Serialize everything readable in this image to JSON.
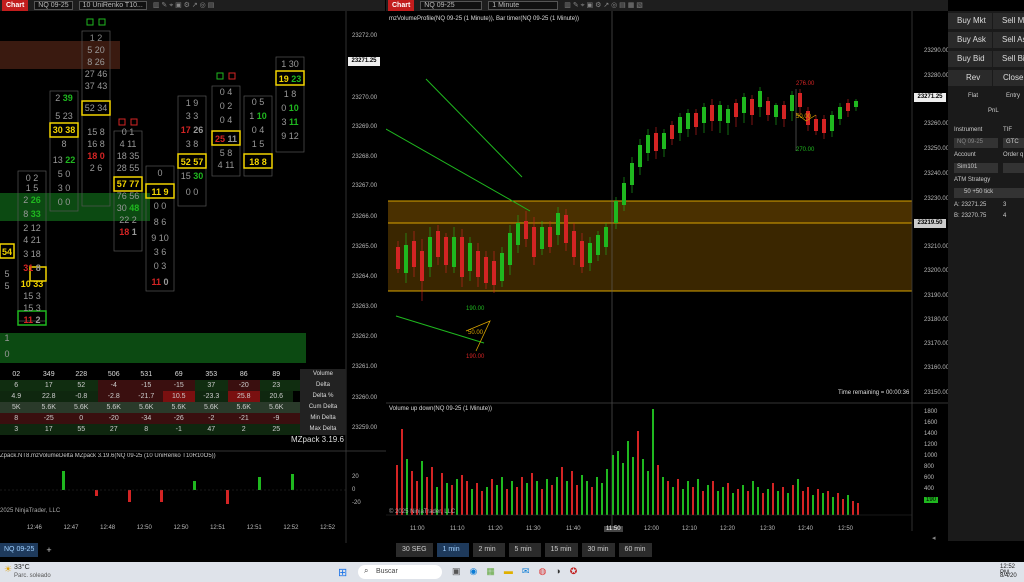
{
  "left_chart": {
    "tab": "Chart",
    "instrument": "NQ 09-25",
    "bar_type": "10 UniRenko T10...",
    "price_axis": [
      "23272.00",
      "23271.00",
      "23270.00",
      "23269.00",
      "23268.00",
      "23267.00",
      "23266.00",
      "23265.00",
      "23264.00",
      "23263.00",
      "23262.00",
      "23261.00",
      "23260.00",
      "23259.00"
    ],
    "current_price": "23271.25",
    "time_axis": [
      "12:46",
      "12:47",
      "12:48",
      "12:50",
      "12:50",
      "12:51",
      "12:51",
      "12:52",
      "12:52"
    ],
    "stats_rows": [
      {
        "label": "Volume",
        "values": [
          "02",
          "349",
          "228",
          "506",
          "531",
          "69",
          "353",
          "86",
          "89",
          "136"
        ]
      },
      {
        "label": "Delta",
        "values": [
          "6",
          "17",
          "52",
          "-4",
          "-15",
          "-15",
          "37",
          "-20",
          "23",
          "28"
        ]
      },
      {
        "label": "Delta %",
        "values": [
          "4.9",
          "22.8",
          "-0.8",
          "-2.8",
          "-21.7",
          "10.5",
          "-23.3",
          "25.8",
          "20.6"
        ]
      },
      {
        "label": "Cum Delta",
        "values": [
          "5K",
          "5.6K",
          "5.6K",
          "5.6K",
          "5.6K",
          "5.6K",
          "5.6K",
          "5.6K",
          "5.6K",
          "5.7K"
        ]
      },
      {
        "label": "Min Delta",
        "values": [
          "8",
          "-25",
          "0",
          "-20",
          "-34",
          "-26",
          "-2",
          "-21",
          "-9",
          "1"
        ]
      },
      {
        "label": "Max Delta",
        "values": [
          "3",
          "17",
          "55",
          "27",
          "8",
          "-1",
          "47",
          "2",
          "25",
          "31"
        ]
      }
    ],
    "watermark": "MZpack 3.19.6",
    "lower_title": "Zpack.NT8.mzVolumeDelta MZpack 3.19.6(NQ 09-25 (10 UniRenko T10R10O5))",
    "lower_axis": [
      "20",
      "0",
      "-20"
    ],
    "copyright": "2025 NinjaTrader, LLC"
  },
  "right_chart": {
    "tab": "Chart",
    "instrument": "NQ 09-25",
    "bar_type": "1 Minute",
    "title": "mzVolumeProfile(NQ 09-25 (1 Minute)), Bar timer(NQ 09-25 (1 Minute))",
    "price_axis": [
      "23290.00",
      "23280.00",
      "23270.00",
      "23260.00",
      "23250.00",
      "23240.00",
      "23230.00",
      "23220.00",
      "23210.00",
      "23200.00",
      "23190.00",
      "23180.00",
      "23170.00",
      "23160.00",
      "23150.00"
    ],
    "current_price": "23271.25",
    "line_price": "23219.50",
    "labels": [
      "276.00",
      "50.00",
      "270.00",
      "190.00",
      "50.00",
      "190.00"
    ],
    "time_remaining": "Time remaining = 00:00:36",
    "volume_title": "Volume up down(NQ 09-25 (1 Minute))",
    "volume_axis": [
      "1800",
      "1600",
      "1400",
      "1200",
      "1000",
      "800",
      "600",
      "400",
      "200"
    ],
    "volume_tag": "190",
    "time_axis": [
      "11:00",
      "11:10",
      "11:20",
      "11:30",
      "11:40",
      "11:50",
      "12:00",
      "12:10",
      "12:20",
      "12:30",
      "12:40",
      "12:50"
    ],
    "copyright": "© 2025 NinjaTrader, LLC"
  },
  "order_panel": {
    "buttons": [
      "Buy Mkt",
      "Sell Mkt",
      "Buy Ask",
      "Sell Ask",
      "Buy Bid",
      "Sell Bid",
      "Rev",
      "Close",
      "Flat",
      "Entry",
      "PnL"
    ],
    "instrument_label": "Instrument",
    "instrument_value": "NQ 09-25",
    "tif_label": "TIF",
    "tif_value": "GTC",
    "account_label": "Account",
    "account_value": "Sim101",
    "order_label": "Order q",
    "atm_label": "ATM Strategy",
    "atm_value": "50 +50 tick",
    "ask": "A: 23271.25",
    "ask_qty": "3",
    "bid": "B: 23270.75",
    "bid_qty": "4"
  },
  "timeframes": [
    "30 SEG",
    "1 min",
    "2 min",
    "5 min",
    "15 min",
    "30 min",
    "60 min"
  ],
  "active_timeframe": "1 min",
  "bottom_tab": "NQ 09-25",
  "add_tab": "+",
  "taskbar": {
    "weather_temp": "33°C",
    "weather_desc": "Parc. soleado",
    "search": "Buscar",
    "clock_time": "12:52 PM",
    "clock_date": "8/4/20"
  },
  "colors": {
    "up": "#1fb81f",
    "down": "#d42424",
    "highlight": "#f2d400",
    "accent": "#c21d1d"
  }
}
